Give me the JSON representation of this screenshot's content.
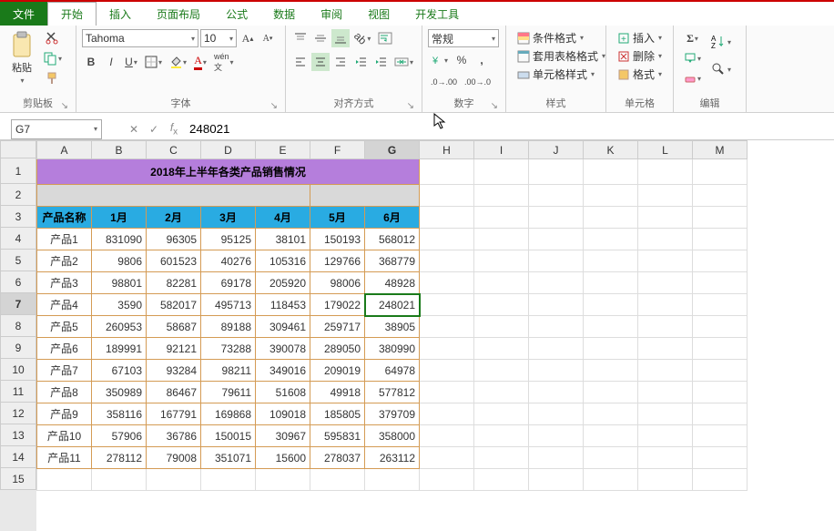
{
  "menu": {
    "file": "文件",
    "tabs": [
      "开始",
      "插入",
      "页面布局",
      "公式",
      "数据",
      "审阅",
      "视图",
      "开发工具"
    ],
    "active": 0
  },
  "ribbon": {
    "clipboard": {
      "label": "剪贴板",
      "paste": "粘贴"
    },
    "font": {
      "label": "字体",
      "name": "Tahoma",
      "size": "10"
    },
    "align": {
      "label": "对齐方式"
    },
    "number": {
      "label": "数字",
      "format": "常规"
    },
    "styles": {
      "label": "样式",
      "cond": "条件格式",
      "table": "套用表格格式",
      "cell": "单元格样式"
    },
    "cells": {
      "label": "单元格",
      "insert": "插入",
      "delete": "删除",
      "format": "格式"
    },
    "editing": {
      "label": "编辑"
    }
  },
  "fx": {
    "name": "G7",
    "value": "248021"
  },
  "columns": [
    "A",
    "B",
    "C",
    "D",
    "E",
    "F",
    "G",
    "H",
    "I",
    "J",
    "K",
    "L",
    "M"
  ],
  "title": "2018年上半年各类产品销售情况",
  "headers": [
    "产品名称",
    "1月",
    "2月",
    "3月",
    "4月",
    "5月",
    "6月"
  ],
  "rows": [
    [
      "产品1",
      "831090",
      "96305",
      "95125",
      "38101",
      "150193",
      "568012"
    ],
    [
      "产品2",
      "9806",
      "601523",
      "40276",
      "105316",
      "129766",
      "368779"
    ],
    [
      "产品3",
      "98801",
      "82281",
      "69178",
      "205920",
      "98006",
      "48928"
    ],
    [
      "产品4",
      "3590",
      "582017",
      "495713",
      "118453",
      "179022",
      "248021"
    ],
    [
      "产品5",
      "260953",
      "58687",
      "89188",
      "309461",
      "259717",
      "38905"
    ],
    [
      "产品6",
      "189991",
      "92121",
      "73288",
      "390078",
      "289050",
      "380990"
    ],
    [
      "产品7",
      "67103",
      "93284",
      "98211",
      "349016",
      "209019",
      "64978"
    ],
    [
      "产品8",
      "350989",
      "86467",
      "79611",
      "51608",
      "49918",
      "577812"
    ],
    [
      "产品9",
      "358116",
      "167791",
      "169868",
      "109018",
      "185805",
      "379709"
    ],
    [
      "产品10",
      "57906",
      "36786",
      "150015",
      "30967",
      "595831",
      "358000"
    ],
    [
      "产品11",
      "278112",
      "79008",
      "351071",
      "15600",
      "278037",
      "263112"
    ]
  ],
  "active": {
    "row": 7,
    "col": "G"
  }
}
